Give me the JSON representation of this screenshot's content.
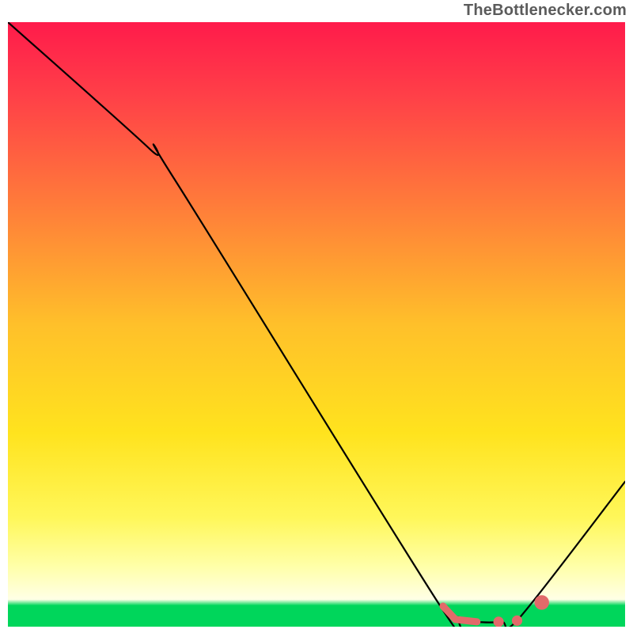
{
  "attribution": "TheBottlenecker.com",
  "chart_data": {
    "type": "line",
    "title": "",
    "xlabel": "",
    "ylabel": "",
    "xlim": [
      0,
      100
    ],
    "ylim": [
      0,
      100
    ],
    "gradient_stops": [
      {
        "offset": 0,
        "color": "#ff1b4b"
      },
      {
        "offset": 0.12,
        "color": "#ff3f48"
      },
      {
        "offset": 0.3,
        "color": "#ff7b3a"
      },
      {
        "offset": 0.5,
        "color": "#ffc02a"
      },
      {
        "offset": 0.68,
        "color": "#ffe31e"
      },
      {
        "offset": 0.82,
        "color": "#fff75a"
      },
      {
        "offset": 0.9,
        "color": "#ffffa8"
      },
      {
        "offset": 0.955,
        "color": "#ffffe6"
      },
      {
        "offset": 0.965,
        "color": "#00d65b"
      },
      {
        "offset": 1.0,
        "color": "#00d65b"
      }
    ],
    "series": [
      {
        "name": "bottleneck-curve",
        "color": "#000000",
        "points": [
          {
            "x": 0,
            "y": 100
          },
          {
            "x": 23,
            "y": 79
          },
          {
            "x": 27,
            "y": 74
          },
          {
            "x": 70,
            "y": 3.5
          },
          {
            "x": 73,
            "y": 1.6
          },
          {
            "x": 76,
            "y": 0.8
          },
          {
            "x": 80,
            "y": 0.8
          },
          {
            "x": 83,
            "y": 1.6
          },
          {
            "x": 100,
            "y": 24
          }
        ]
      }
    ],
    "markers": {
      "color": "#e26a6a",
      "thick_segment": [
        {
          "x": 70.5,
          "y": 3.4
        },
        {
          "x": 72.5,
          "y": 1.2
        },
        {
          "x": 76.0,
          "y": 0.8
        }
      ],
      "dots": [
        {
          "x": 79.5,
          "y": 0.8,
          "r": 3.0
        },
        {
          "x": 82.5,
          "y": 1.0,
          "r": 3.0
        },
        {
          "x": 86.5,
          "y": 4.0,
          "r": 4.2
        }
      ]
    }
  }
}
